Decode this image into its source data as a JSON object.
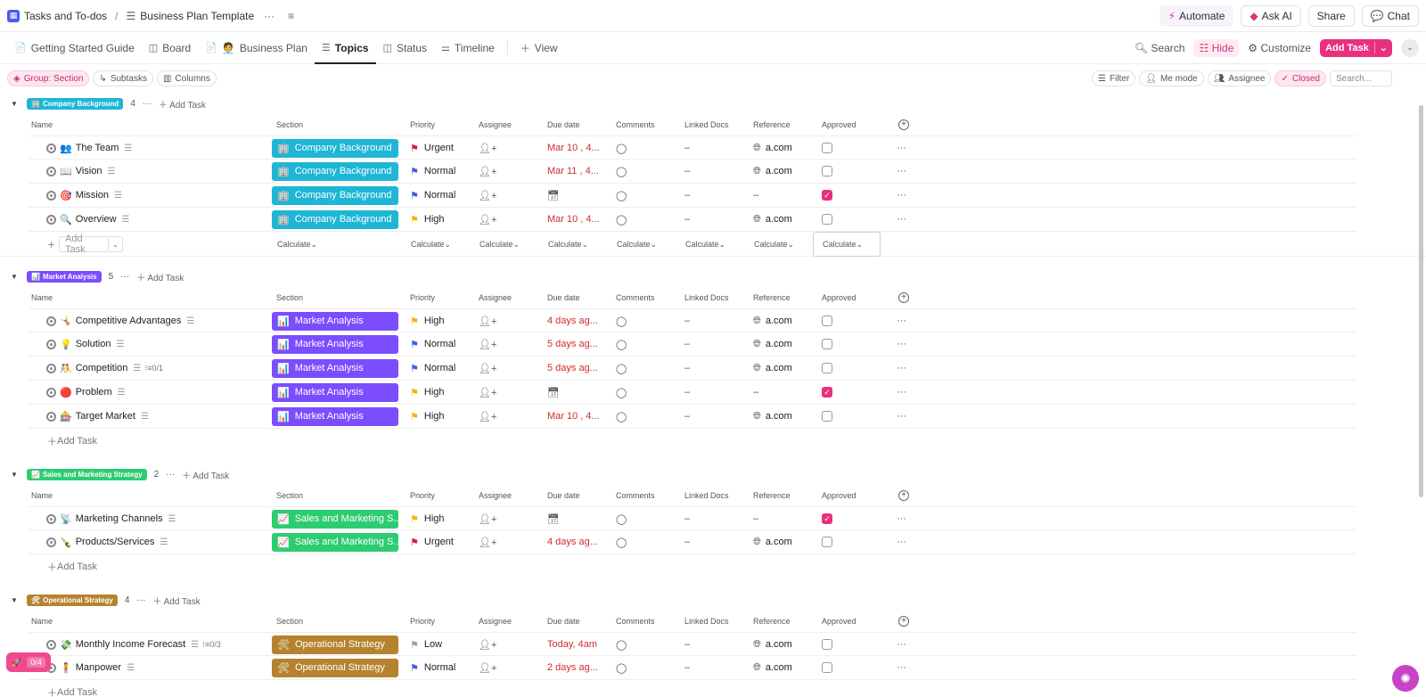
{
  "breadcrumb": {
    "space": "Tasks and To-dos",
    "separator": "/",
    "list": "Business Plan Template",
    "more": "···"
  },
  "top_actions": {
    "automate": "Automate",
    "ask_ai": "Ask AI",
    "share": "Share",
    "chat": "Chat"
  },
  "views": [
    {
      "label": "Getting Started Guide",
      "icon": "doc-icon"
    },
    {
      "label": "Board",
      "icon": "board-icon"
    },
    {
      "label": "Business Plan",
      "icon": "doc-icon",
      "emoji": "🧑‍💼"
    },
    {
      "label": "Topics",
      "icon": "list-icon",
      "active": true
    },
    {
      "label": "Status",
      "icon": "board-icon"
    },
    {
      "label": "Timeline",
      "icon": "timeline-icon"
    }
  ],
  "view_add": "View",
  "view_actions": {
    "search": "Search",
    "hide": "Hide",
    "customize": "Customize",
    "add_task": "Add Task"
  },
  "filters_left": {
    "group": "Group: Section",
    "subtasks": "Subtasks",
    "columns": "Columns"
  },
  "filters_right": {
    "filter": "Filter",
    "me_mode": "Me mode",
    "assignee": "Assignee",
    "closed": "Closed",
    "search_placeholder": "Search..."
  },
  "columns": {
    "name": "Name",
    "section": "Section",
    "priority": "Priority",
    "assignee": "Assignee",
    "due": "Due date",
    "comments": "Comments",
    "linked_docs": "Linked Docs",
    "reference": "Reference",
    "approved": "Approved"
  },
  "labels": {
    "add_task": "Add Task",
    "calculate": "Calculate",
    "dash": "–",
    "more": "···"
  },
  "colors": {
    "company": "#1fb6d6",
    "market": "#7c4dff",
    "sales": "#2ecc71",
    "operational": "#b5832f",
    "accent": "#e8307e",
    "urgent": "#d0203a",
    "high": "#f5b300",
    "normal": "#3f5be8",
    "low": "#9e9e9e"
  },
  "groups": [
    {
      "id": "company",
      "name": "Company Background",
      "emoji": "🏢",
      "count": "4",
      "show_calc": true,
      "tasks": [
        {
          "emoji": "👥",
          "name": "The Team",
          "section": "Company Background",
          "priority": "Urgent",
          "due": "Mar 10 , 4...",
          "due_kind": "date",
          "reference": "a.com",
          "approved": false
        },
        {
          "emoji": "📖",
          "name": "Vision",
          "section": "Company Background",
          "priority": "Normal",
          "due": "Mar 11 , 4...",
          "due_kind": "date",
          "reference": "a.com",
          "approved": false
        },
        {
          "emoji": "🎯",
          "name": "Mission",
          "section": "Company Background",
          "priority": "Normal",
          "due": "",
          "due_kind": "none",
          "reference": "",
          "approved": true
        },
        {
          "emoji": "🔍",
          "name": "Overview",
          "section": "Company Background",
          "priority": "High",
          "due": "Mar 10 , 4...",
          "due_kind": "date",
          "reference": "a.com",
          "approved": false
        }
      ]
    },
    {
      "id": "market",
      "name": "Market Analysis",
      "emoji": "📊",
      "count": "5",
      "show_calc": false,
      "tasks": [
        {
          "emoji": "🤸",
          "name": "Competitive Advantages",
          "section": "Market Analysis",
          "priority": "High",
          "due": "4 days ag...",
          "due_kind": "date",
          "reference": "a.com",
          "approved": false
        },
        {
          "emoji": "💡",
          "name": "Solution",
          "section": "Market Analysis",
          "priority": "Normal",
          "due": "5 days ag...",
          "due_kind": "date",
          "reference": "a.com",
          "approved": false
        },
        {
          "emoji": "🤼",
          "name": "Competition",
          "section": "Market Analysis",
          "priority": "Normal",
          "due": "5 days ag...",
          "due_kind": "date",
          "reference": "a.com",
          "approved": false,
          "subtasks": "0/1"
        },
        {
          "emoji": "🔴",
          "name": "Problem",
          "section": "Market Analysis",
          "priority": "High",
          "due": "",
          "due_kind": "none",
          "reference": "",
          "approved": true
        },
        {
          "emoji": "🎰",
          "name": "Target Market",
          "section": "Market Analysis",
          "priority": "High",
          "due": "Mar 10 , 4...",
          "due_kind": "date",
          "reference": "a.com",
          "approved": false
        }
      ]
    },
    {
      "id": "sales",
      "name": "Sales and Marketing Strategy",
      "emoji": "📈",
      "count": "2",
      "show_calc": false,
      "tasks": [
        {
          "emoji": "📡",
          "name": "Marketing Channels",
          "section": "Sales and Marketing S...",
          "priority": "High",
          "due": "",
          "due_kind": "none",
          "reference": "",
          "approved": true
        },
        {
          "emoji": "🍾",
          "name": "Products/Services",
          "section": "Sales and Marketing S...",
          "priority": "Urgent",
          "due": "4 days ag...",
          "due_kind": "date",
          "reference": "a.com",
          "approved": false
        }
      ]
    },
    {
      "id": "operational",
      "name": "Operational Strategy",
      "emoji": "🛠",
      "count": "4",
      "show_calc": false,
      "tasks": [
        {
          "emoji": "💸",
          "name": "Monthly Income Forecast",
          "section": "Operational Strategy",
          "priority": "Low",
          "due": "Today, 4am",
          "due_kind": "date",
          "reference": "a.com",
          "approved": false,
          "subtasks": "0/3"
        },
        {
          "emoji": "🧍",
          "name": "Manpower",
          "section": "Operational Strategy",
          "priority": "Normal",
          "due": "2 days ag...",
          "due_kind": "date",
          "reference": "a.com",
          "approved": false
        }
      ]
    }
  ],
  "floating": {
    "progress": "0/4"
  }
}
